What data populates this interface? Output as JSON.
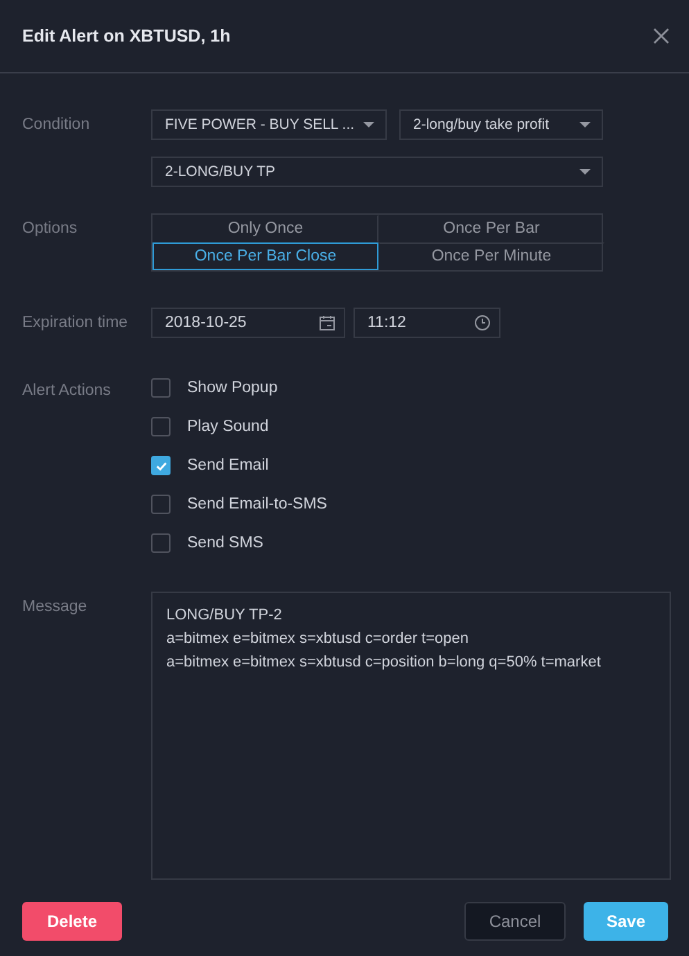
{
  "dialog": {
    "title": "Edit Alert on XBTUSD, 1h"
  },
  "condition": {
    "label": "Condition",
    "selects": [
      {
        "value": "FIVE POWER - BUY SELL ..."
      },
      {
        "value": "2-long/buy take profit"
      },
      {
        "value": "2-LONG/BUY TP"
      }
    ]
  },
  "options": {
    "label": "Options",
    "items": [
      {
        "label": "Only Once",
        "selected": false
      },
      {
        "label": "Once Per Bar",
        "selected": false
      },
      {
        "label": "Once Per Bar Close",
        "selected": true
      },
      {
        "label": "Once Per Minute",
        "selected": false
      }
    ]
  },
  "expiration": {
    "label": "Expiration time",
    "date": "2018-10-25",
    "time": "11:12"
  },
  "actions": {
    "label": "Alert Actions",
    "items": [
      {
        "label": "Show Popup",
        "checked": false
      },
      {
        "label": "Play Sound",
        "checked": false
      },
      {
        "label": "Send Email",
        "checked": true
      },
      {
        "label": "Send Email-to-SMS",
        "checked": false
      },
      {
        "label": "Send SMS",
        "checked": false
      }
    ]
  },
  "message": {
    "label": "Message",
    "value": "LONG/BUY TP-2\na=bitmex e=bitmex s=xbtusd c=order t=open\na=bitmex e=bitmex s=xbtusd c=position b=long q=50% t=market"
  },
  "buttons": [
    {
      "label": "Delete",
      "kind": "danger"
    },
    {
      "label": "Cancel",
      "kind": "secondary"
    },
    {
      "label": "Save",
      "kind": "primary"
    }
  ]
}
